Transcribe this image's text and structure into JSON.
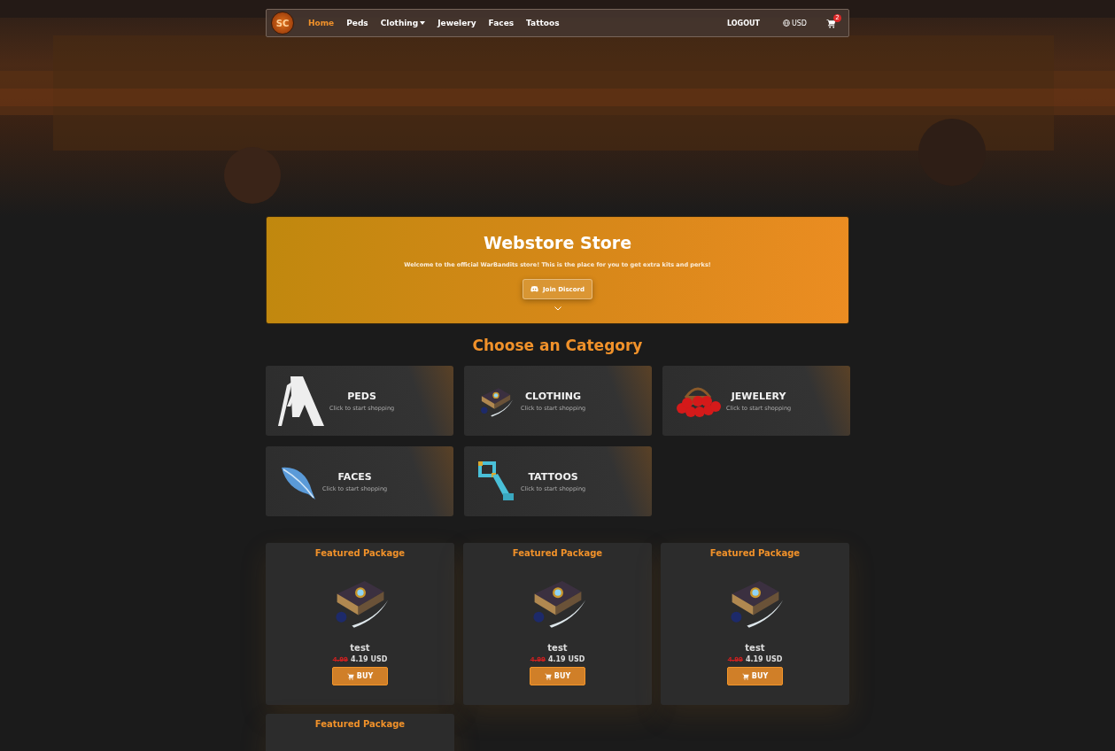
{
  "nav": {
    "logo": "SC",
    "items": [
      {
        "label": "Home",
        "selected": true,
        "kind": "link"
      },
      {
        "label": "Peds",
        "selected": false,
        "kind": "link"
      },
      {
        "label": "Clothing",
        "selected": false,
        "kind": "dropdown"
      },
      {
        "label": "Jewelery",
        "selected": false,
        "kind": "link"
      },
      {
        "label": "Faces",
        "selected": false,
        "kind": "link"
      },
      {
        "label": "Tattoos",
        "selected": false,
        "kind": "link"
      }
    ],
    "logout": "LOGOUT",
    "currency": "USD",
    "cart_count": "2"
  },
  "banner": {
    "title": "Webstore Store",
    "text": "Welcome to the official WarBandits store! This is the place for you to get extra kits and perks!",
    "button": "Join Discord"
  },
  "categories_heading": "Choose an Category",
  "categories": [
    {
      "name": "PEDS",
      "hint": "Click to start shopping",
      "kind": "logo"
    },
    {
      "name": "CLOTHING",
      "hint": "Click to start shopping",
      "kind": "book"
    },
    {
      "name": "JEWELERY",
      "hint": "Click to start shopping",
      "kind": "basket"
    },
    {
      "name": "FACES",
      "hint": "Click to start shopping",
      "kind": "feather"
    },
    {
      "name": "TATTOOS",
      "hint": "Click to start shopping",
      "kind": "key"
    }
  ],
  "packages": [
    {
      "label": "Featured Package",
      "name": "test",
      "old_price": "4.99",
      "price": "4.19 USD",
      "button": "BUY"
    },
    {
      "label": "Featured Package",
      "name": "test",
      "old_price": "4.99",
      "price": "4.19 USD",
      "button": "BUY"
    },
    {
      "label": "Featured Package",
      "name": "test",
      "old_price": "4.99",
      "price": "4.19 USD",
      "button": "BUY"
    },
    {
      "label": "Featured Package"
    }
  ]
}
